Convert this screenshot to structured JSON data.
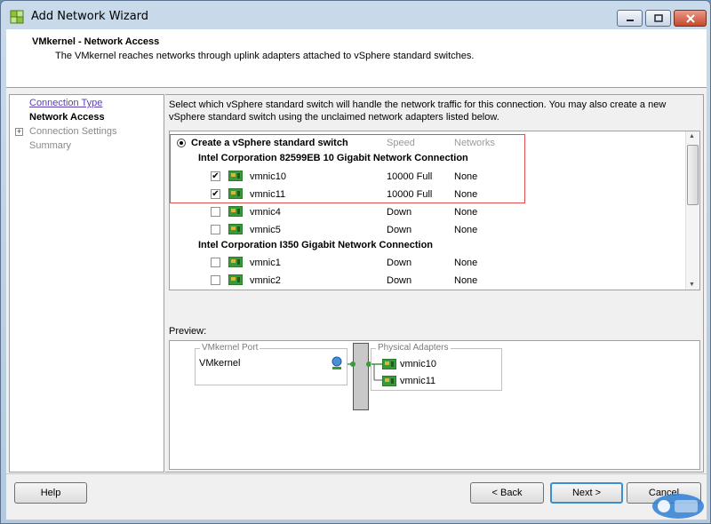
{
  "window": {
    "title": "Add Network Wizard"
  },
  "header": {
    "title": "VMkernel - Network Access",
    "subtitle": "The VMkernel reaches networks through uplink adapters attached to vSphere standard switches."
  },
  "nav": {
    "items": [
      {
        "label": "Connection Type",
        "state": "link"
      },
      {
        "label": "Network Access",
        "state": "current"
      },
      {
        "label": "Connection Settings",
        "state": "disabled",
        "expander": "+"
      },
      {
        "label": "Summary",
        "state": "disabled"
      }
    ]
  },
  "main": {
    "instructions": "Select which vSphere standard switch will handle the network traffic for this connection. You may also create a new vSphere standard switch using the unclaimed network adapters listed below.",
    "create_option": {
      "label": "Create a vSphere standard switch",
      "selected": true
    },
    "columns": {
      "speed": "Speed",
      "networks": "Networks"
    },
    "groups": [
      {
        "title": "Intel Corporation 82599EB 10 Gigabit Network Connection",
        "adapters": [
          {
            "name": "vmnic10",
            "speed": "10000 Full",
            "networks": "None",
            "checked": true
          },
          {
            "name": "vmnic11",
            "speed": "10000 Full",
            "networks": "None",
            "checked": true
          },
          {
            "name": "vmnic4",
            "speed": "Down",
            "networks": "None",
            "checked": false
          },
          {
            "name": "vmnic5",
            "speed": "Down",
            "networks": "None",
            "checked": false
          }
        ]
      },
      {
        "title": "Intel Corporation I350 Gigabit Network Connection",
        "adapters": [
          {
            "name": "vmnic1",
            "speed": "Down",
            "networks": "None",
            "checked": false
          },
          {
            "name": "vmnic2",
            "speed": "Down",
            "networks": "None",
            "checked": false
          }
        ]
      }
    ]
  },
  "preview": {
    "label": "Preview:",
    "vmkernel_port_legend": "VMkernel Port",
    "vmkernel_port_name": "VMkernel",
    "physical_adapters_legend": "Physical Adapters",
    "physical_adapters": [
      "vmnic10",
      "vmnic11"
    ]
  },
  "buttons": {
    "help": "Help",
    "back": "< Back",
    "next": "Next >",
    "cancel": "Cancel"
  },
  "colors": {
    "highlight_border": "#e05050",
    "link": "#5b3fb0",
    "nic_green": "#3a9a3a"
  },
  "icons": {
    "window": "vsphere-wizard-icon",
    "nic": "network-adapter-icon",
    "vmkernel": "vmkernel-port-icon"
  }
}
